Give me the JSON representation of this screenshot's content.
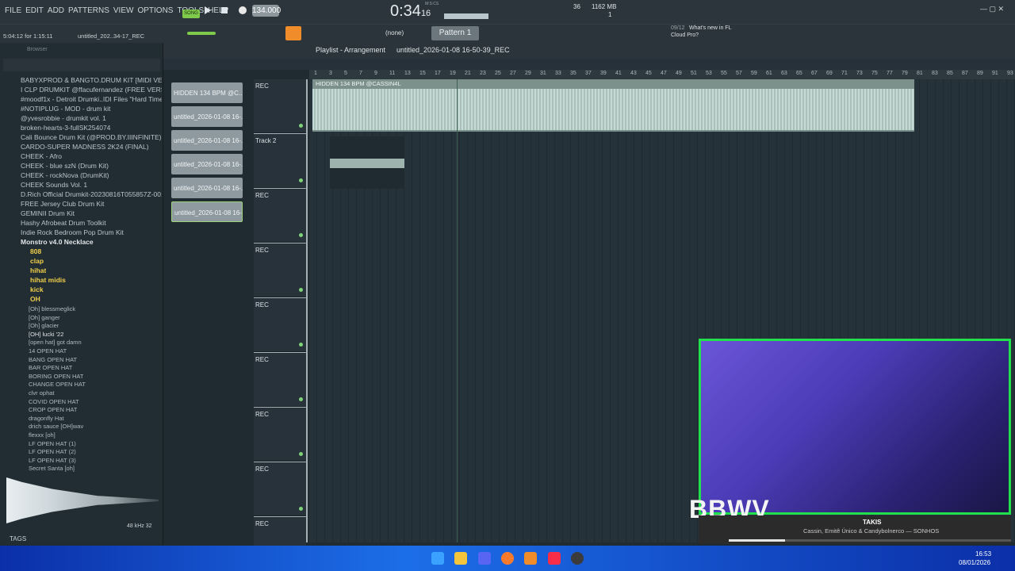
{
  "menu": [
    "FILE",
    "EDIT",
    "ADD",
    "PATTERNS",
    "VIEW",
    "OPTIONS",
    "TOOLS",
    "HELP"
  ],
  "transport": {
    "mode": "SONG",
    "tempo": "134.000",
    "time": "0:34",
    "time_sub": "16",
    "time_label": "M:S:CS",
    "memory": "1162 MB",
    "cpu": "36",
    "voices": "1"
  },
  "status": {
    "position": "5:04:12 for 1:15:11",
    "project": "untitled_202..34-17_REC"
  },
  "snap": "(none)",
  "pattern": "Pattern 1",
  "news": {
    "count": "09/12",
    "line1": "What's new in FL",
    "line2": "Cloud Pro?"
  },
  "browser": {
    "title": "Browser",
    "folders": [
      "BABYXPROD & BANGTO.DRUM KIT [MIDI VERSION]",
      "I CLP DRUMKIT @ffacufernandez (FREE VERSION)",
      "#moodf1x - Detroit Drumki..IDI Files \"Hard Times\"",
      "#NOTIPLUG - MOD - drum kit",
      "@yvesrobbie - drumkit vol. 1",
      "broken-hearts-3-fullSK254074",
      "Cali Bounce Drum Kit (@PROD.BY.IIINFINITE)",
      "CARDO-SUPER MADNESS 2K24 (FINAL)",
      "CHEEK - Afro",
      "CHEEK - blue szN (Drum Kit)",
      "CHEEK - rockNova (DrumKit)",
      "CHEEK Sounds Vol. 1",
      "D.Rich Official Drumkit-20230816T055857Z-001",
      "FREE Jersey Club Drum Kit",
      "GEMINII Drum Kit",
      "Hashy Afrobeat Drum Toolkit",
      "Indie Rock Bedroom Pop Drum Kit",
      "Monstro v4.0 Necklace"
    ],
    "subfolders": [
      "808",
      "clap",
      "hihat",
      "hihat midis",
      "kick",
      "OH"
    ],
    "files": [
      "[Oh] blessmeglick",
      "[Oh] ganger",
      "[Oh] glacier",
      "[OH] lucki '22",
      "[open hat] got damn",
      "14 OPEN HAT",
      "BANG OPEN HAT",
      "BAR OPEN HAT",
      "BORING OPEN HAT",
      "CHANGE OPEN HAT",
      "clvr ophat",
      "COVID OPEN HAT",
      "CROP OPEN HAT",
      "dragonfly Hat",
      "drich sauce [OH]wav",
      "flexxx [oh]",
      "LF OPEN HAT (1)",
      "LF OPEN HAT (2)",
      "LF OPEN HAT (3)",
      "Secret Santa [oh]"
    ],
    "sample_rate": "48 kHz 32",
    "tags": "TAGS"
  },
  "playlist": {
    "title": "Playlist - Arrangement",
    "project": "untitled_2026-01-08 16-50-39_REC"
  },
  "patterns": [
    "HIDDEN 134 BPM @C...",
    "untitled_2026-01-08 16-...",
    "untitled_2026-01-08 16-...",
    "untitled_2026-01-08 16-...",
    "untitled_2026-01-08 16-...",
    "untitled_2026-01-08 16-..."
  ],
  "tracks": [
    "REC",
    "Track 2",
    "REC",
    "REC",
    "REC",
    "REC",
    "REC",
    "REC",
    "REC"
  ],
  "clip_label": "HIDDEN 134 BPM @CASSIN4L",
  "bars": [
    "1",
    "3",
    "5",
    "7",
    "9",
    "11",
    "13",
    "15",
    "17",
    "19",
    "21",
    "23",
    "25",
    "27",
    "29",
    "31",
    "33",
    "35",
    "37",
    "39",
    "41",
    "43",
    "45",
    "47",
    "49",
    "51",
    "53",
    "55",
    "57",
    "59",
    "61",
    "63",
    "65",
    "67",
    "69",
    "71",
    "73",
    "75",
    "77",
    "79",
    "81",
    "83",
    "85",
    "87",
    "89",
    "91",
    "93"
  ],
  "overlay": {
    "logo": "BBWV",
    "song": "TAKIS",
    "artist": "Cassin, Emitê Único & Candybolnerco — SONHOS"
  },
  "clock": {
    "time": "16:53",
    "date": "08/01/2026"
  },
  "colors": {
    "accent": "#f08c2a",
    "webcam_border": "#21e04c",
    "clip": "#b9cfc9"
  }
}
